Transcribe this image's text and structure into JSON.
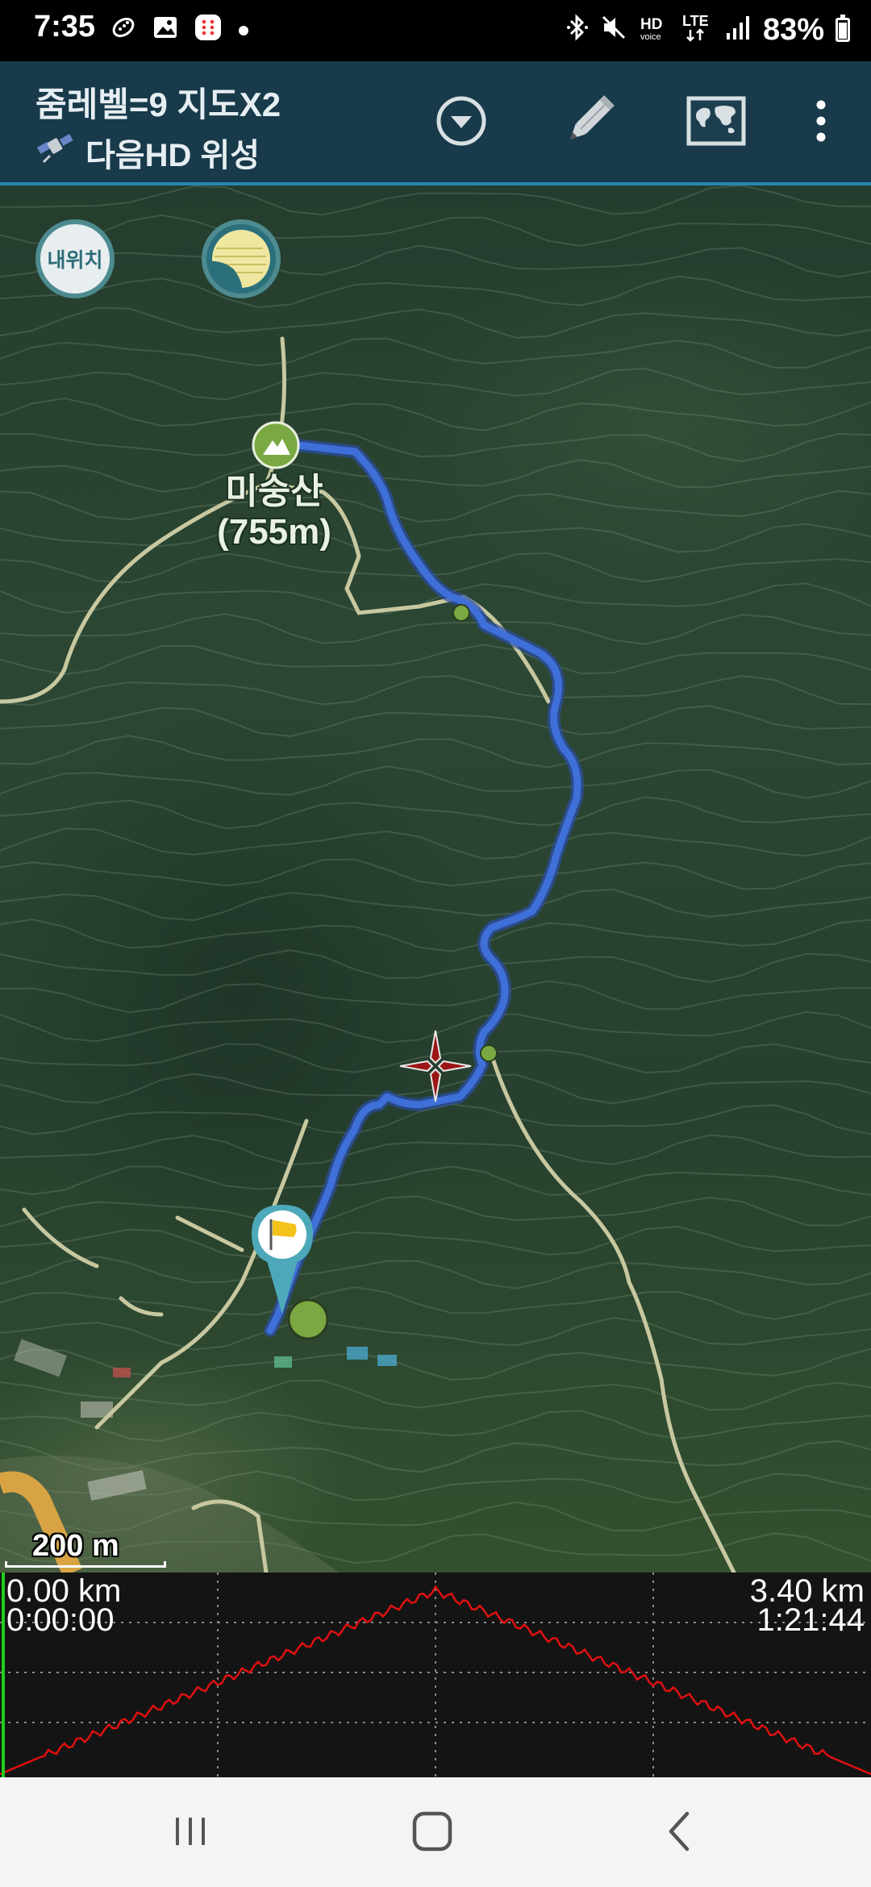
{
  "status_bar": {
    "time": "7:35",
    "network": "HD voice LTE",
    "battery_level": "83%",
    "battery_fraction": 0.83,
    "icons_left": [
      "running-shoe-icon",
      "gallery-icon",
      "app-notification-icon",
      "dot-icon"
    ],
    "icons_right": [
      "bluetooth-icon",
      "mute-icon",
      "hd-voice-icon",
      "lte-icon",
      "signal-icon",
      "battery-icon"
    ]
  },
  "toolbar": {
    "title": "줌레벨=9 지도X2",
    "map_source": "다음HD 위성",
    "actions": [
      "dropdown-icon",
      "pencil-icon",
      "world-map-icon",
      "more-vert-icon"
    ]
  },
  "map": {
    "my_location_label": "내위치",
    "peak_name": "미숭산",
    "peak_elevation": "(755m)",
    "scale_label": "200 m",
    "track_color": "#3f6fd8",
    "trail_color": "#c8c8a0"
  },
  "profile": {
    "start_distance": "0.00 km",
    "start_time": "0:00:00",
    "end_distance": "3.40 km",
    "end_time": "1:21:44",
    "line_color": "#e01010",
    "cursor_color": "#22cc22"
  },
  "nav": {
    "icons": [
      "recent-apps-icon",
      "home-icon",
      "back-icon"
    ]
  }
}
